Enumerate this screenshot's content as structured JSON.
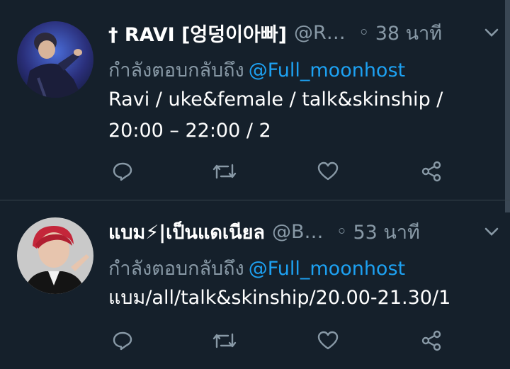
{
  "tweets": [
    {
      "display_name": "† RAVI [엉덩이아빠]",
      "handle": "@R…",
      "separator": "◦",
      "time": "38 นาที",
      "reply_prefix": "กำลังตอบกลับถึง",
      "reply_mention": "@Full_moonhost",
      "text": "Ravi / uke&female / talk&skinship / 20:00 – 22:00 / 2",
      "avatar_icon": "user-avatar-photo"
    },
    {
      "display_name": "แบม⚡|เป็นแดเนียล",
      "handle": "@B…",
      "separator": "◦",
      "time": "53 นาที",
      "reply_prefix": "กำลังตอบกลับถึง",
      "reply_mention": "@Full_moonhost",
      "text": "แบม/all/talk&skinship/20.00-21.30/1",
      "avatar_icon": "user-avatar-photo"
    }
  ],
  "actions": [
    "reply-icon",
    "retweet-icon",
    "like-icon",
    "share-icon"
  ],
  "colors": {
    "background": "#15202b",
    "secondary_text": "#8899a6",
    "link": "#1da1f2",
    "divider": "#38444d"
  }
}
